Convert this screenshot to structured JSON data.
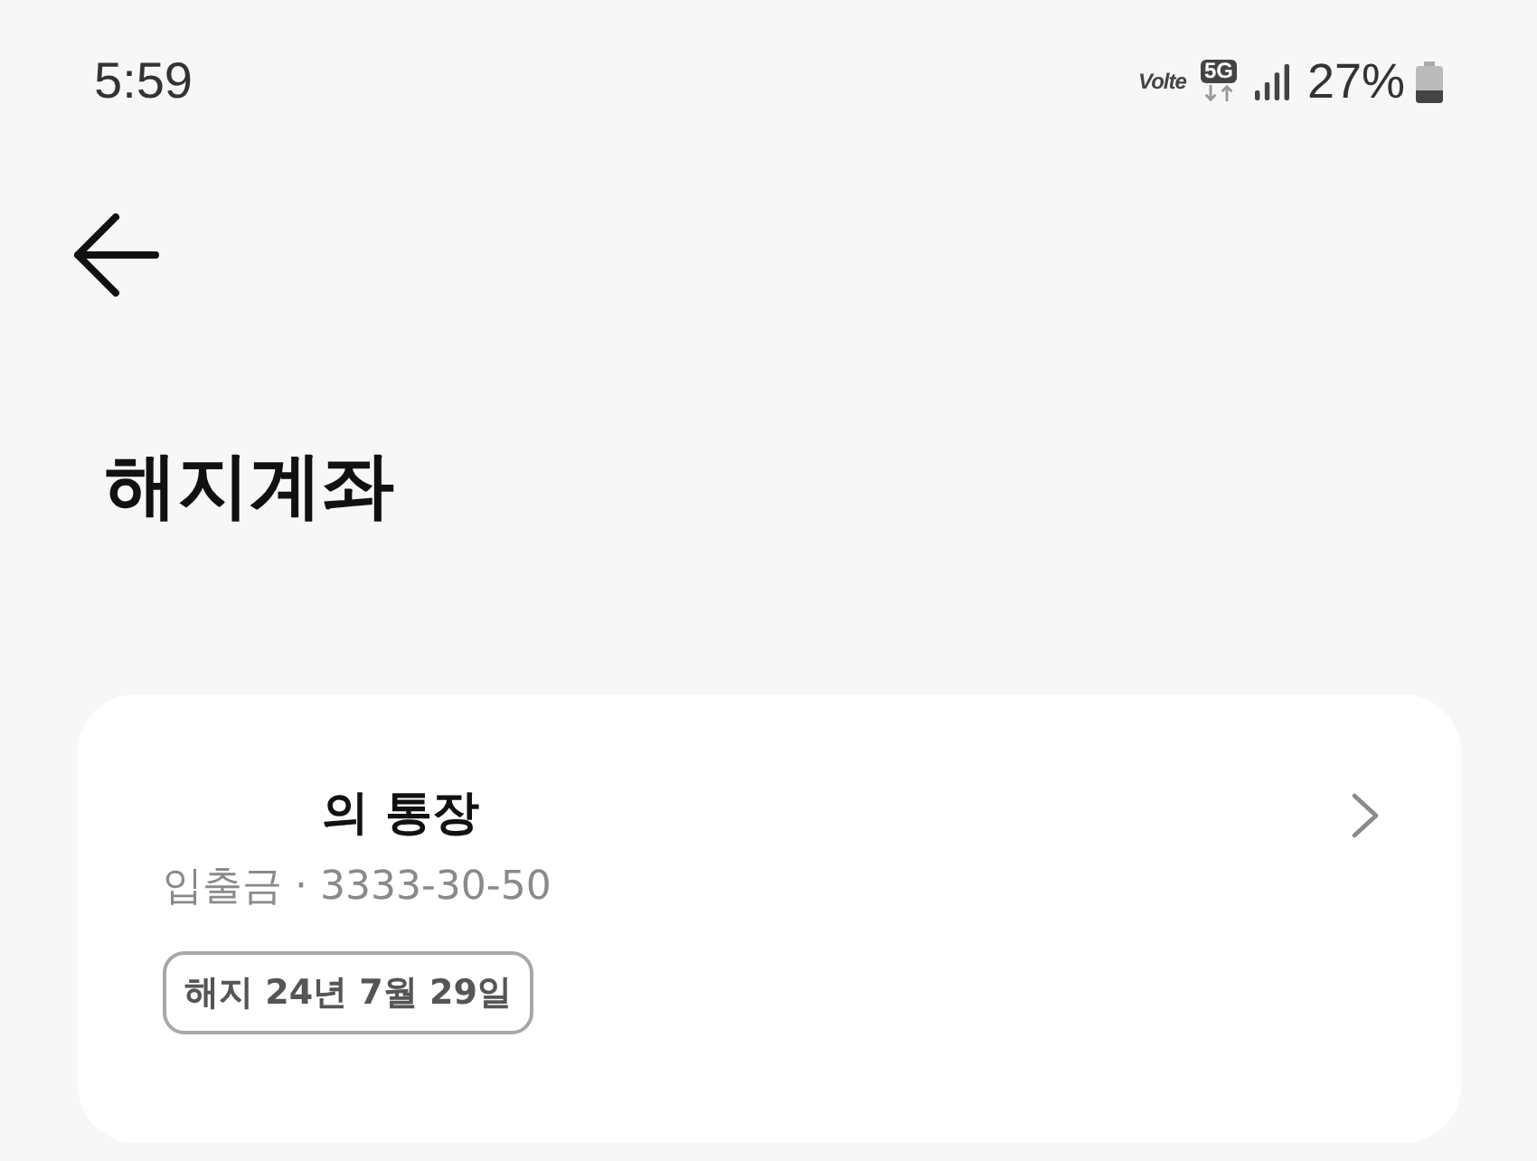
{
  "status_bar": {
    "time": "5:59",
    "volte": "Volte",
    "network": "5G",
    "battery_percent": "27%"
  },
  "page": {
    "title": "해지계좌"
  },
  "accounts": [
    {
      "name": "의 통장",
      "detail": "입출금 · 3333-30-50",
      "tag": "해지 24년 7월 29일"
    }
  ]
}
